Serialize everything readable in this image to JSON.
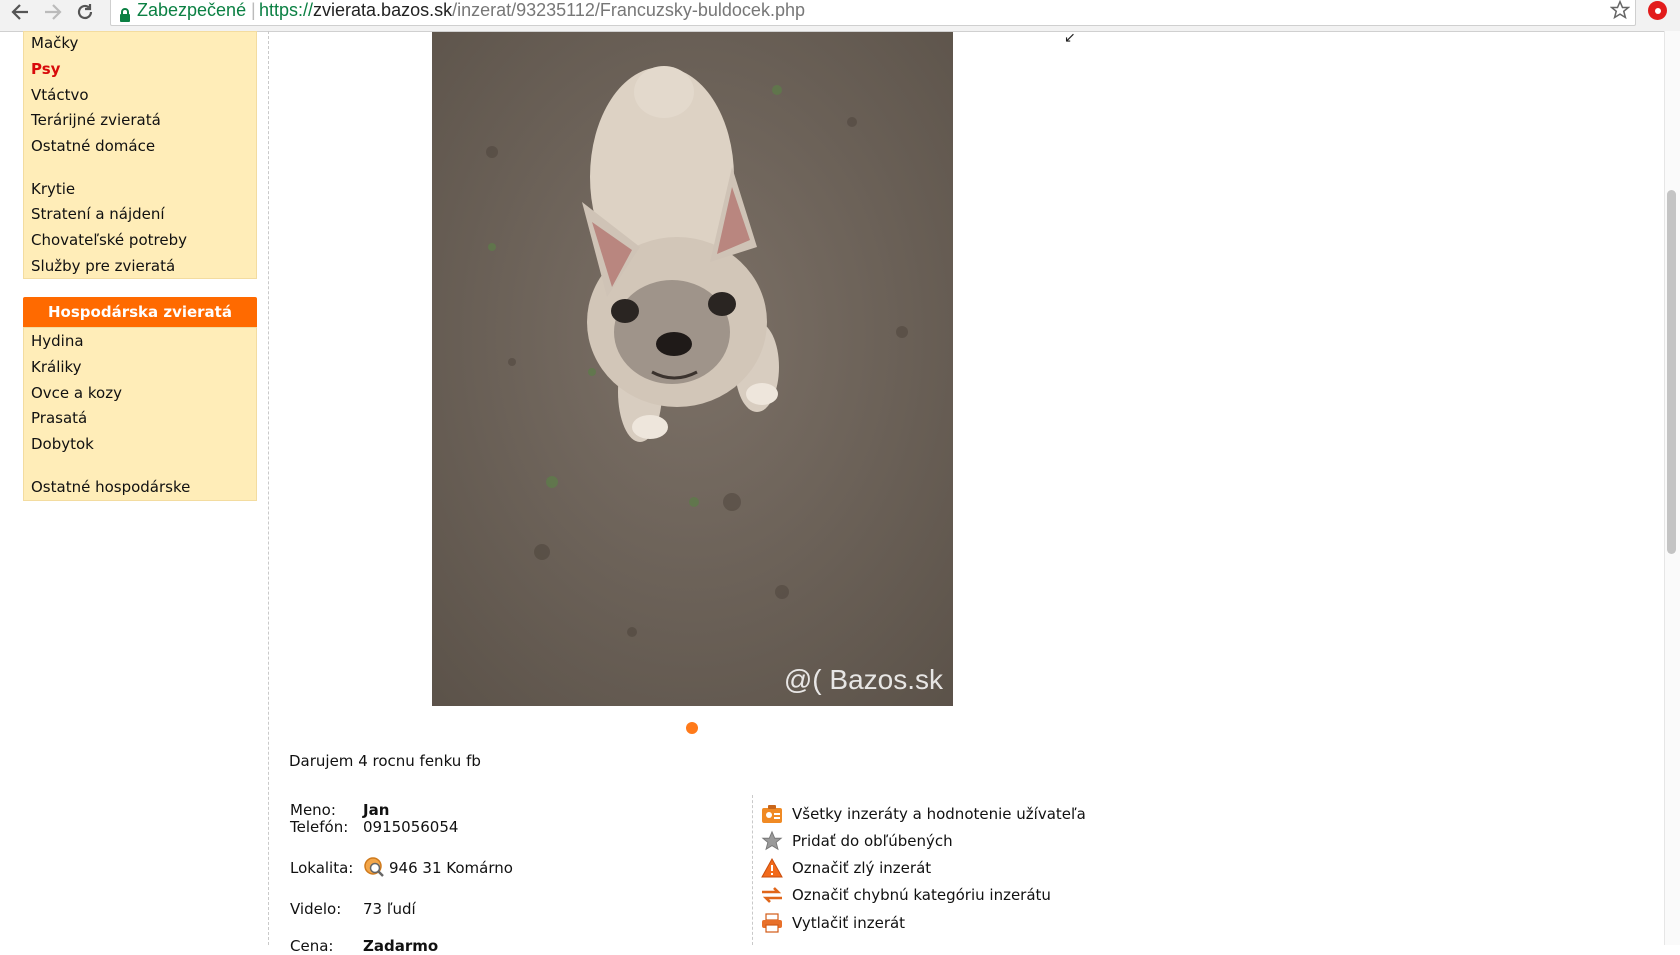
{
  "browser": {
    "secure_label": "Zabezpečené",
    "separator": "|",
    "url_scheme": "https://",
    "url_host": "zvierata.bazos.sk",
    "url_path": "/inzerat/93235112/Francuzsky-buldocek.php"
  },
  "sidebar": {
    "group1": [
      {
        "label": "Mačky",
        "active": false
      },
      {
        "label": "Psy",
        "active": true
      },
      {
        "label": "Vtáctvo",
        "active": false
      },
      {
        "label": "Terárijné zvieratá",
        "active": false
      },
      {
        "label": "Ostatné domáce",
        "active": false
      }
    ],
    "group2": [
      "Krytie",
      "Stratení a nájdení",
      "Chovateľské potreby",
      "Služby pre zvieratá"
    ],
    "farm_header": "Hospodárska zvieratá",
    "farm_items": [
      "Hydina",
      "Králiky",
      "Ovce a kozy",
      "Prasatá",
      "Dobytok"
    ],
    "farm_other": "Ostatné hospodárske"
  },
  "listing": {
    "watermark_text": "@( Bazos.sk",
    "description": "Darujem 4 rocnu fenku fb",
    "name_label": "Meno:",
    "name_value": "Jan",
    "phone_label": "Telefón:",
    "phone_value": "0915056054",
    "location_label": "Lokalita:",
    "location_value": "946 31 Komárno",
    "views_label": "Videlo:",
    "views_value": "73 ľudí",
    "price_label": "Cena:",
    "price_value": "Zadarmo"
  },
  "actions": [
    {
      "label": "Všetky inzeráty a hodnotenie užívateľa",
      "icon": "user-ads-icon"
    },
    {
      "label": "Pridať do obľúbených",
      "icon": "star-icon"
    },
    {
      "label": "Označiť zlý inzerát",
      "icon": "warning-icon"
    },
    {
      "label": "Označiť chybnú kategóriu inzerátu",
      "icon": "arrows-icon"
    },
    {
      "label": "Vytlačiť inzerát",
      "icon": "printer-icon"
    }
  ],
  "colors": {
    "sidebar_bg": "#ffedb8",
    "header_orange": "#ff6a00",
    "active_red": "#d80b0b",
    "secure_green": "#0b8043"
  }
}
